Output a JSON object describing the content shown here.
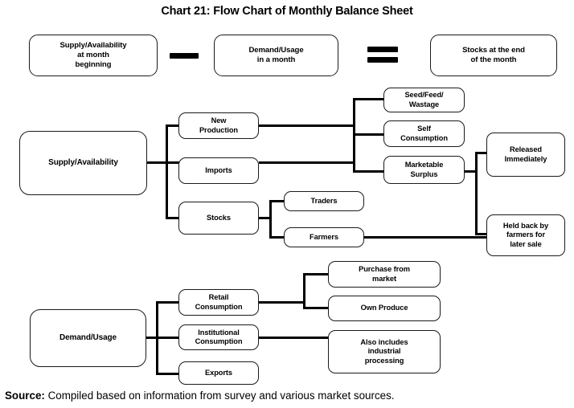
{
  "title": "Chart 21: Flow Chart of Monthly Balance Sheet",
  "equation": {
    "term1": "Supply/Availability\nat month\nbeginning",
    "operator_minus": "−",
    "term2": "Demand/Usage\nin a month",
    "operator_equals": "=",
    "term3": "Stocks at the end\nof the month"
  },
  "supply_branch": {
    "root": "Supply/Availability",
    "level1": [
      "New\nProduction",
      "Imports",
      "Stocks"
    ],
    "stocks_children": [
      "Traders",
      "Farmers"
    ],
    "production_children": [
      "Seed/Feed/\nWastage",
      "Self\nConsumption",
      "Marketable\nSurplus"
    ],
    "surplus_children": [
      "Released\nImmediately",
      "Held back by\nfarmers for\nlater sale"
    ]
  },
  "demand_branch": {
    "root": "Demand/Usage",
    "level1": [
      "Retail\nConsumption",
      "Institutional\nConsumption",
      "Exports"
    ],
    "retail_children": [
      "Purchase from\nmarket",
      "Own Produce"
    ],
    "institutional_note": "Also includes\nindustrial\nprocessing"
  },
  "source": {
    "label": "Source:",
    "text": " Compiled based on information from survey and various market sources."
  },
  "colors": {
    "line": "#000000",
    "box_border": "#1a1a1a",
    "background": "#ffffff",
    "text": "#000000"
  }
}
